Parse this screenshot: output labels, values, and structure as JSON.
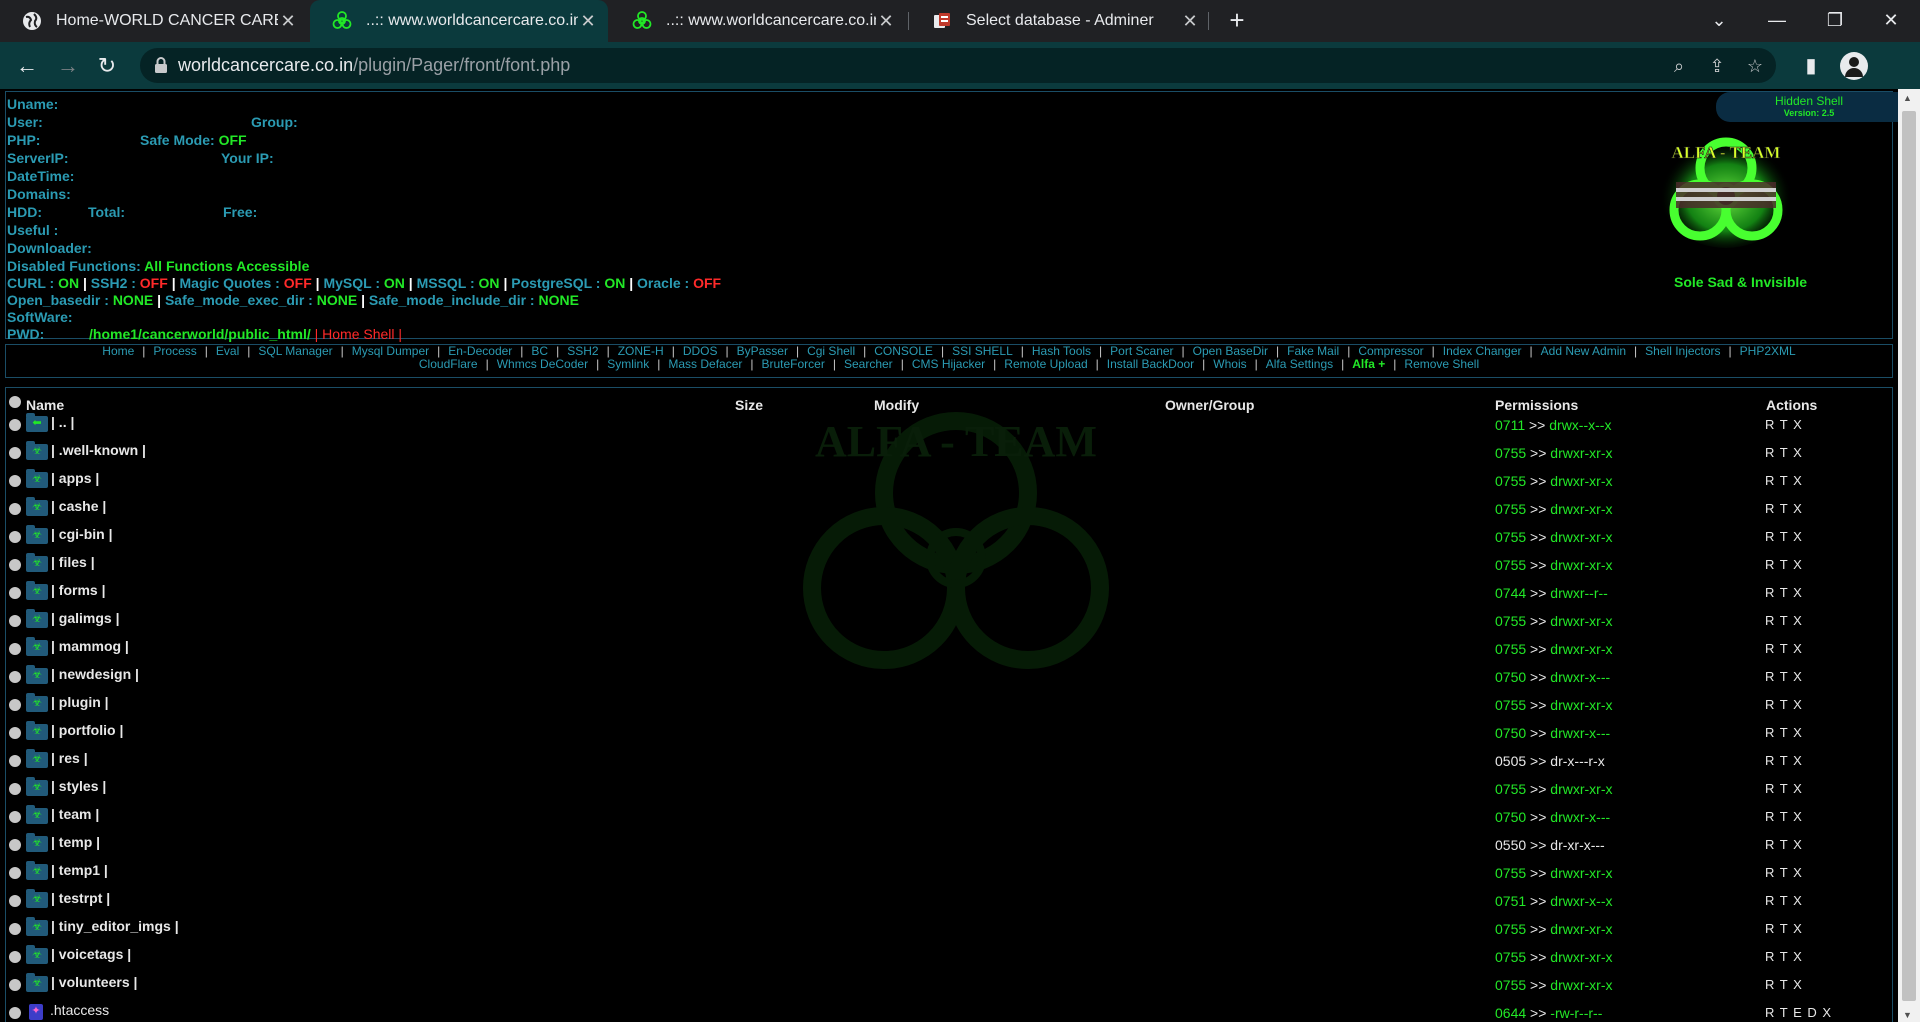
{
  "browser": {
    "tabs": [
      {
        "title": "Home-WORLD CANCER CARE CHARITABLE SOCIETY",
        "favicon": "chrome-globe-icon",
        "active": false
      },
      {
        "title": "..:: www.worldcancercare.co.in ~ Alfa ::..",
        "favicon": "biohazard-icon",
        "active": true
      },
      {
        "title": "..:: www.worldcancercare.co.in ~ Alfa ::..",
        "favicon": "biohazard-icon",
        "active": false
      },
      {
        "title": "Select database - Adminer",
        "favicon": "adminer-icon",
        "active": false
      }
    ],
    "url_host": "worldcancercare.co.in",
    "url_path": "/plugin/Pager/front/font.php",
    "accent": "#0b3a3d"
  },
  "info": {
    "uname_label": "Uname:",
    "user_label": "User:",
    "group_label": "Group:",
    "php_label": "PHP:",
    "safemode_label": "Safe Mode:",
    "safemode_val": "OFF",
    "serverip_label": "ServerIP:",
    "yourip_label": "Your IP:",
    "datetime_label": "DateTime:",
    "domains_label": "Domains:",
    "hdd_label": "HDD:",
    "total_label": "Total:",
    "free_label": "Free:",
    "useful_label": "Useful :",
    "downloader_label": "Downloader:",
    "disabled_label": "Disabled Functions:",
    "disabled_val": "All Functions Accessible",
    "curl_label": "CURL :",
    "curl_val": "ON",
    "ssh2_label": "SSH2 :",
    "ssh2_val": "OFF",
    "magic_label": "Magic Quotes :",
    "magic_val": "OFF",
    "mysql_label": "MySQL :",
    "mysql_val": "ON",
    "mssql_label": "MSSQL :",
    "mssql_val": "ON",
    "pgsql_label": "PostgreSQL :",
    "pgsql_val": "ON",
    "oracle_label": "Oracle :",
    "oracle_val": "OFF",
    "openbasedir_label": "Open_basedir :",
    "openbasedir_val": "NONE",
    "execdir_label": "Safe_mode_exec_dir :",
    "execdir_val": "NONE",
    "includedir_label": "Safe_mode_include_dir :",
    "includedir_val": "NONE",
    "software_label": "SoftWare:",
    "pwd_label": "PWD:",
    "pwd_val": "/home1/cancerworld/public_html/",
    "homeshell": "| Home Shell |"
  },
  "badge": {
    "title": "Hidden Shell",
    "version": "Version: 2.5"
  },
  "logo_text": "ALFA - TEAM",
  "slogan": "Sole Sad & Invisible",
  "menu": {
    "row1": [
      "Home",
      "Process",
      "Eval",
      "SQL Manager",
      "Mysql Dumper",
      "En-Decoder",
      "BC",
      "SSH2",
      "ZONE-H",
      "DDOS",
      "ByPasser",
      "Cgi Shell",
      "CONSOLE",
      "SSI SHELL",
      "Hash Tools",
      "Port Scaner",
      "Open BaseDir",
      "Fake Mail",
      "Compressor",
      "Index Changer",
      "Add New Admin",
      "Shell Injectors",
      "PHP2XML"
    ],
    "row2": [
      "CloudFlare",
      "Whmcs DeCoder",
      "Symlink",
      "Mass Defacer",
      "BruteForcer",
      "Searcher",
      "CMS Hijacker",
      "Remote Upload",
      "Install BackDoor",
      "Whois",
      "Alfa Settings",
      "Alfa +",
      "Remove Shell"
    ]
  },
  "table": {
    "headers": {
      "name": "Name",
      "size": "Size",
      "modify": "Modify",
      "owner": "Owner/Group",
      "perms": "Permissions",
      "actions": "Actions"
    },
    "rows": [
      {
        "name": "| .. |",
        "perm": "0711",
        "mode": "drwx--x--x",
        "w": false,
        "acts": "R T X",
        "up": true
      },
      {
        "name": "| .well-known |",
        "perm": "0755",
        "mode": "drwxr-xr-x",
        "w": false,
        "acts": "R T X"
      },
      {
        "name": "| apps |",
        "perm": "0755",
        "mode": "drwxr-xr-x",
        "w": false,
        "acts": "R T X"
      },
      {
        "name": "| cashe |",
        "perm": "0755",
        "mode": "drwxr-xr-x",
        "w": false,
        "acts": "R T X"
      },
      {
        "name": "| cgi-bin |",
        "perm": "0755",
        "mode": "drwxr-xr-x",
        "w": false,
        "acts": "R T X"
      },
      {
        "name": "| files |",
        "perm": "0755",
        "mode": "drwxr-xr-x",
        "w": false,
        "acts": "R T X"
      },
      {
        "name": "| forms |",
        "perm": "0744",
        "mode": "drwxr--r--",
        "w": false,
        "acts": "R T X"
      },
      {
        "name": "| galimgs |",
        "perm": "0755",
        "mode": "drwxr-xr-x",
        "w": false,
        "acts": "R T X"
      },
      {
        "name": "| mammog |",
        "perm": "0755",
        "mode": "drwxr-xr-x",
        "w": false,
        "acts": "R T X"
      },
      {
        "name": "| newdesign |",
        "perm": "0750",
        "mode": "drwxr-x---",
        "w": false,
        "acts": "R T X"
      },
      {
        "name": "| plugin |",
        "perm": "0755",
        "mode": "drwxr-xr-x",
        "w": false,
        "acts": "R T X"
      },
      {
        "name": "| portfolio |",
        "perm": "0750",
        "mode": "drwxr-x---",
        "w": false,
        "acts": "R T X"
      },
      {
        "name": "| res |",
        "perm": "0505",
        "mode": "dr-x---r-x",
        "w": true,
        "acts": "R T X"
      },
      {
        "name": "| styles |",
        "perm": "0755",
        "mode": "drwxr-xr-x",
        "w": false,
        "acts": "R T X"
      },
      {
        "name": "| team |",
        "perm": "0750",
        "mode": "drwxr-x---",
        "w": false,
        "acts": "R T X"
      },
      {
        "name": "| temp |",
        "perm": "0550",
        "mode": "dr-xr-x---",
        "w": true,
        "acts": "R T X"
      },
      {
        "name": "| temp1 |",
        "perm": "0755",
        "mode": "drwxr-xr-x",
        "w": false,
        "acts": "R T X"
      },
      {
        "name": "| testrpt |",
        "perm": "0751",
        "mode": "drwxr-x--x",
        "w": false,
        "acts": "R T X"
      },
      {
        "name": "| tiny_editor_imgs |",
        "perm": "0755",
        "mode": "drwxr-xr-x",
        "w": false,
        "acts": "R T X"
      },
      {
        "name": "| voicetags |",
        "perm": "0755",
        "mode": "drwxr-xr-x",
        "w": false,
        "acts": "R T X"
      },
      {
        "name": "| volunteers |",
        "perm": "0755",
        "mode": "drwxr-xr-x",
        "w": false,
        "acts": "R T X"
      },
      {
        "name": ".htaccess",
        "perm": "0644",
        "mode": "-rw-r--r--",
        "w": false,
        "acts": "R T E D X",
        "file": true
      }
    ]
  }
}
